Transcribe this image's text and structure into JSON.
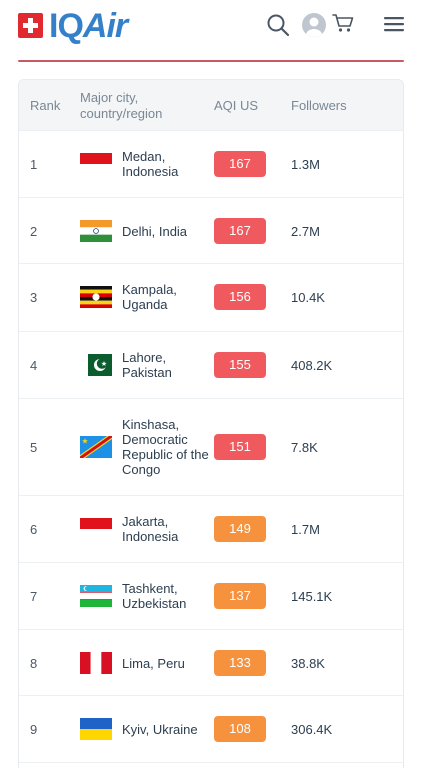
{
  "header": {
    "logo_main": "IQ",
    "logo_air": "Air"
  },
  "table": {
    "columns": [
      "Rank",
      "Major city, country/region",
      "AQI US",
      "Followers"
    ],
    "rows": [
      {
        "rank": "1",
        "city": "Medan, Indonesia",
        "aqi": "167",
        "followers": "1.3M",
        "flag": "indonesia-flag-icon"
      },
      {
        "rank": "2",
        "city": "Delhi, India",
        "aqi": "167",
        "followers": "2.7M",
        "flag": "india-flag-icon"
      },
      {
        "rank": "3",
        "city": "Kampala, Uganda",
        "aqi": "156",
        "followers": "10.4K",
        "flag": "uganda-flag-icon"
      },
      {
        "rank": "4",
        "city": "Lahore, Pakistan",
        "aqi": "155",
        "followers": "408.2K",
        "flag": "pakistan-flag-icon"
      },
      {
        "rank": "5",
        "city": "Kinshasa, Democratic Republic of the Congo",
        "aqi": "151",
        "followers": "7.8K",
        "flag": "dr-congo-flag-icon"
      },
      {
        "rank": "6",
        "city": "Jakarta, Indonesia",
        "aqi": "149",
        "followers": "1.7M",
        "flag": "indonesia-flag-icon"
      },
      {
        "rank": "7",
        "city": "Tashkent, Uzbekistan",
        "aqi": "137",
        "followers": "145.1K",
        "flag": "uzbekistan-flag-icon"
      },
      {
        "rank": "8",
        "city": "Lima, Peru",
        "aqi": "133",
        "followers": "38.8K",
        "flag": "peru-flag-icon"
      },
      {
        "rank": "9",
        "city": "Kyiv, Ukraine",
        "aqi": "108",
        "followers": "306.4K",
        "flag": "ukraine-flag-icon"
      }
    ]
  },
  "colors": {
    "brand_blue": "#3581c9",
    "logo_red": "#e12a30",
    "aqi_unhealthy": "#f05a5f",
    "aqi_unhealthy_sensitive": "#f6923e"
  }
}
